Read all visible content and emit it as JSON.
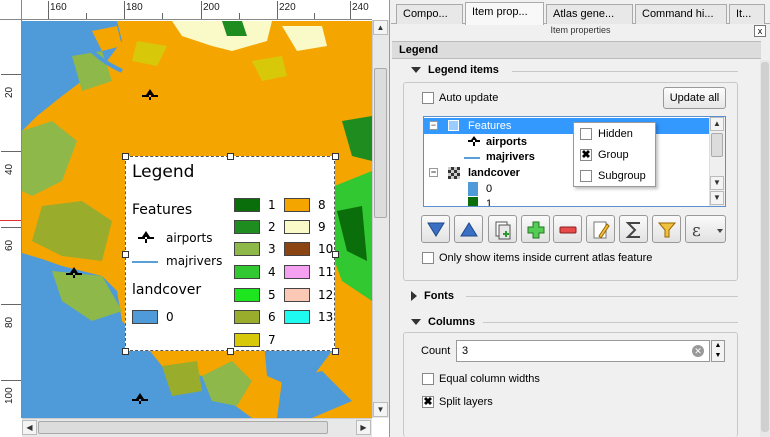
{
  "ruler": {
    "h_labels": [
      "160",
      "180",
      "200",
      "220",
      "240"
    ],
    "v_labels": [
      "20",
      "40",
      "60",
      "80",
      "100"
    ]
  },
  "map_legend": {
    "title": "Legend",
    "group_features": "Features",
    "airports": "airports",
    "majrivers": "majrivers",
    "group_landcover": "landcover",
    "classes": [
      {
        "label": "0",
        "color": "#4f9ad8"
      },
      {
        "label": "1",
        "color": "#0a6e0a"
      },
      {
        "label": "2",
        "color": "#1e8c1e"
      },
      {
        "label": "3",
        "color": "#8fb84a"
      },
      {
        "label": "4",
        "color": "#32c832"
      },
      {
        "label": "5",
        "color": "#1ee61e"
      },
      {
        "label": "6",
        "color": "#9aac2c"
      },
      {
        "label": "7",
        "color": "#d8c80a"
      },
      {
        "label": "8",
        "color": "#f5a500"
      },
      {
        "label": "9",
        "color": "#fafac8"
      },
      {
        "label": "10",
        "color": "#8b4513"
      },
      {
        "label": "11",
        "color": "#f5a0f0"
      },
      {
        "label": "12",
        "color": "#fac8b4"
      },
      {
        "label": "13",
        "color": "#1efaf0"
      }
    ]
  },
  "tabs": [
    {
      "label": "Compo..."
    },
    {
      "label": "Item prop..."
    },
    {
      "label": "Atlas gene..."
    },
    {
      "label": "Command hi..."
    },
    {
      "label": "It..."
    }
  ],
  "panel": {
    "subtitle": "Item properties",
    "close_glyph": "x",
    "header": "Legend",
    "legend_items_section": "Legend items",
    "auto_update_label": "Auto update",
    "update_all_label": "Update all",
    "only_show_label": "Only show items inside current atlas feature",
    "fonts_section": "Fonts",
    "columns_section": "Columns",
    "count_label": "Count",
    "count_value": "3",
    "equal_widths_label": "Equal column widths",
    "split_layers_label": "Split layers"
  },
  "tree": {
    "features": "Features",
    "airports": "airports",
    "majrivers": "majrivers",
    "landcover": "landcover",
    "class0": "0",
    "class1": "1"
  },
  "menu": {
    "hidden": "Hidden",
    "group": "Group",
    "subgroup": "Subgroup"
  },
  "colors": {
    "selection": "#3399ff",
    "ocean": "#4f9ad8",
    "land_orange": "#f5a500"
  }
}
